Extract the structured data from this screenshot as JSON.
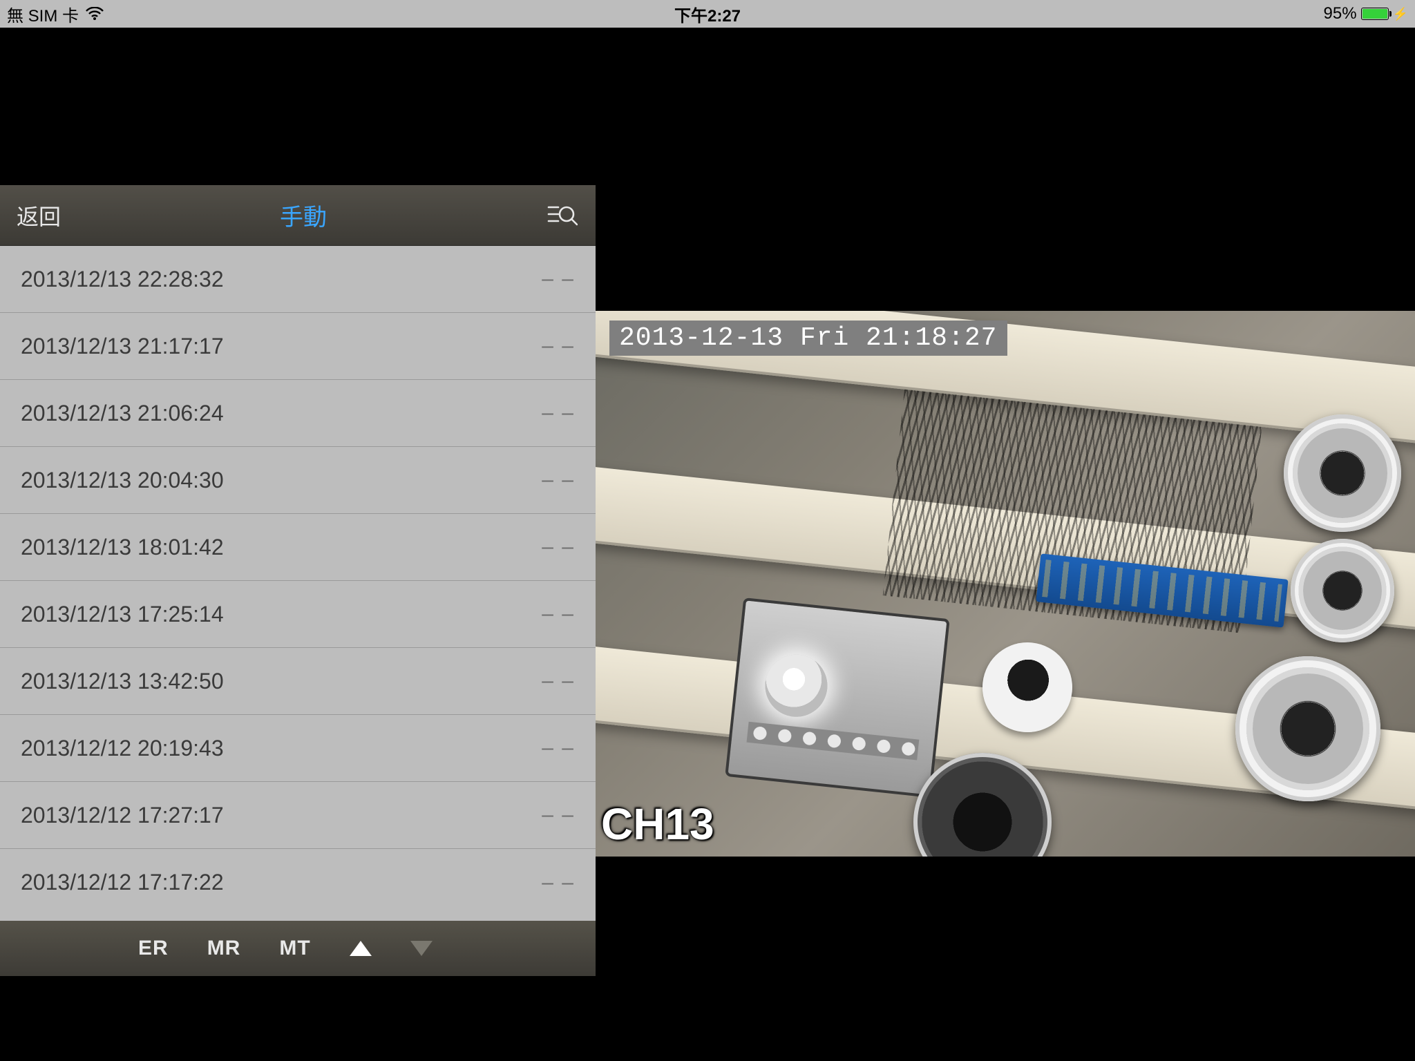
{
  "status_bar": {
    "carrier": "無 SIM 卡",
    "time": "下午2:27",
    "battery_percent": "95%"
  },
  "panel": {
    "back_label": "返回",
    "title": "手動",
    "footer": {
      "er": "ER",
      "mr": "MR",
      "mt": "MT"
    }
  },
  "events": [
    {
      "ts": "2013/12/13 22:28:32",
      "mark": "– –"
    },
    {
      "ts": "2013/12/13 21:17:17",
      "mark": "– –"
    },
    {
      "ts": "2013/12/13 21:06:24",
      "mark": "– –"
    },
    {
      "ts": "2013/12/13 20:04:30",
      "mark": "– –"
    },
    {
      "ts": "2013/12/13 18:01:42",
      "mark": "– –"
    },
    {
      "ts": "2013/12/13 17:25:14",
      "mark": "– –"
    },
    {
      "ts": "2013/12/13 13:42:50",
      "mark": "– –"
    },
    {
      "ts": "2013/12/12 20:19:43",
      "mark": "– –"
    },
    {
      "ts": "2013/12/12 17:27:17",
      "mark": "– –"
    },
    {
      "ts": "2013/12/12 17:17:22",
      "mark": "– –"
    }
  ],
  "video": {
    "osd_timestamp": "2013-12-13 Fri 21:18:27",
    "channel": "CH13"
  }
}
